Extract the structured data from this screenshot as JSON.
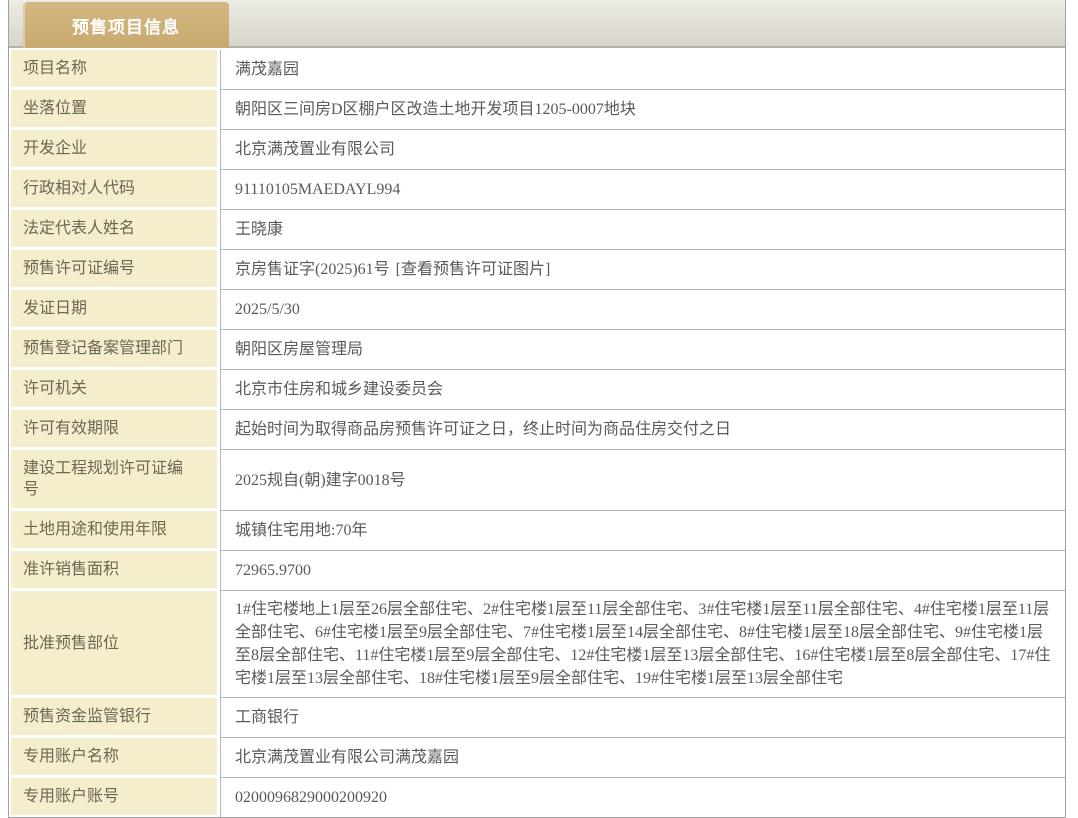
{
  "header": {
    "title_tab": "预售项目信息"
  },
  "colors": {
    "tab_background": "#cdaf75",
    "tab_text": "#ffffff",
    "label_cell_background": "#f4eecd",
    "label_text": "#6a6854",
    "value_text": "#5a5a5a",
    "separator_line": "#b6b6b6",
    "outer_border": "#a2a2a2",
    "header_bar_gradient_top": "#edece5",
    "header_bar_gradient_bottom": "#d7d4c9"
  },
  "table": {
    "rows": [
      {
        "label": "项目名称",
        "value": "满茂嘉园"
      },
      {
        "label": "坐落位置",
        "value": "朝阳区三间房D区棚户区改造土地开发项目1205-0007地块"
      },
      {
        "label": "开发企业",
        "value": "北京满茂置业有限公司"
      },
      {
        "label": "行政相对人代码",
        "value": "91110105MAEDAYL994"
      },
      {
        "label": "法定代表人姓名",
        "value": "王晓康"
      },
      {
        "label": "预售许可证编号",
        "value": "京房售证字(2025)61号",
        "link": "[查看预售许可证图片]"
      },
      {
        "label": "发证日期",
        "value": "2025/5/30"
      },
      {
        "label": "预售登记备案管理部门",
        "value": "朝阳区房屋管理局"
      },
      {
        "label": "许可机关",
        "value": "北京市住房和城乡建设委员会"
      },
      {
        "label": "许可有效期限",
        "value": "起始时间为取得商品房预售许可证之日，终止时间为商品住房交付之日"
      },
      {
        "label": "建设工程规划许可证编号",
        "value": "2025规自(朝)建字0018号"
      },
      {
        "label": "土地用途和使用年限",
        "value": "城镇住宅用地:70年"
      },
      {
        "label": "准许销售面积",
        "value": "72965.9700"
      },
      {
        "label": "批准预售部位",
        "value": "1#住宅楼地上1层至26层全部住宅、2#住宅楼1层至11层全部住宅、3#住宅楼1层至11层全部住宅、4#住宅楼1层至11层全部住宅、6#住宅楼1层至9层全部住宅、7#住宅楼1层至14层全部住宅、8#住宅楼1层至18层全部住宅、9#住宅楼1层至8层全部住宅、11#住宅楼1层至9层全部住宅、12#住宅楼1层至13层全部住宅、16#住宅楼1层至8层全部住宅、17#住宅楼1层至13层全部住宅、18#住宅楼1层至9层全部住宅、19#住宅楼1层至13层全部住宅"
      },
      {
        "label": "预售资金监管银行",
        "value": "工商银行"
      },
      {
        "label": "专用账户名称",
        "value": "北京满茂置业有限公司满茂嘉园"
      },
      {
        "label": "专用账户账号",
        "value": "0200096829000200920"
      }
    ]
  }
}
